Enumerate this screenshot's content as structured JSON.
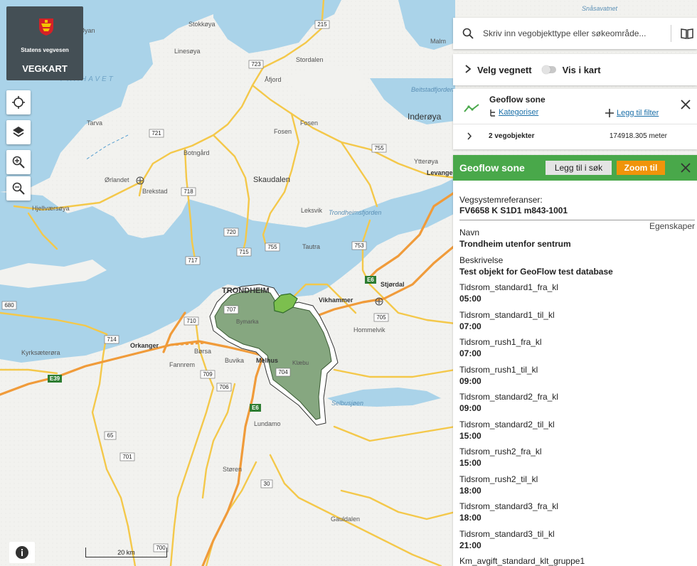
{
  "brand": {
    "org": "Statens vegvesen",
    "app": "VEGKART"
  },
  "search": {
    "placeholder": "Skriv inn vegobjekttype eller søkeområde..."
  },
  "network": {
    "label": "Velg vegnett",
    "toggle_label": "Vis i kart",
    "toggle_on": false
  },
  "object_type": {
    "title": "Geoflow sone",
    "categorize": "Kategoriser",
    "add_filter": "Legg til filter",
    "count": "2 vegobjekter",
    "length": "174918.305 meter"
  },
  "detail": {
    "title": "Geoflow sone",
    "add_search": "Legg til i søk",
    "zoom": "Zoom til",
    "ref_label": "Vegsystemreferanser:",
    "ref_value": "FV6658 K S1D1 m843-1001",
    "section": "Egenskaper",
    "props": [
      {
        "key": "Navn",
        "value": "Trondheim utenfor sentrum"
      },
      {
        "key": "Beskrivelse",
        "value": "Test objekt for GeoFlow test database"
      },
      {
        "key": "Tidsrom_standard1_fra_kl",
        "value": "05:00"
      },
      {
        "key": "Tidsrom_standard1_til_kl",
        "value": "07:00"
      },
      {
        "key": "Tidsrom_rush1_fra_kl",
        "value": "07:00"
      },
      {
        "key": "Tidsrom_rush1_til_kl",
        "value": "09:00"
      },
      {
        "key": "Tidsrom_standard2_fra_kl",
        "value": "09:00"
      },
      {
        "key": "Tidsrom_standard2_til_kl",
        "value": "15:00"
      },
      {
        "key": "Tidsrom_rush2_fra_kl",
        "value": "15:00"
      },
      {
        "key": "Tidsrom_rush2_til_kl",
        "value": "18:00"
      },
      {
        "key": "Tidsrom_standard3_fra_kl",
        "value": "18:00"
      },
      {
        "key": "Tidsrom_standard3_til_kl",
        "value": "21:00"
      },
      {
        "key": "Km_avgift_standard_klt_gruppe1",
        "value": ""
      }
    ]
  },
  "map": {
    "scale": "20 km",
    "sea_label": "FRÅHAVET",
    "city_label": "TRONDHEIM",
    "places": [
      "Stokkøya",
      "Linesøya",
      "Åfjord",
      "Stordalen",
      "Malm",
      "Inderøya",
      "Fosen",
      "Fosen",
      "Tarva",
      "Botngård",
      "Ørlandet",
      "Brekstad",
      "Skaudalen",
      "Ytterøya",
      "Levanger",
      "Hjellværsøya",
      "Leksvik",
      "Trondheimsfjorden",
      "Tautra",
      "Stjørdal",
      "Vikhammer",
      "Hommelvik",
      "Bymarka",
      "Orkanger",
      "Børsa",
      "Fannrem",
      "Buvika",
      "Melhus",
      "Klæbu",
      "Selbusjøen",
      "Kyrksæterøra",
      "Lundamo",
      "Støren",
      "Gauldalen",
      "Beitstadfjorden",
      "Snåsavatnet",
      "Øyan"
    ],
    "road_labels": [
      "215",
      "723",
      "721",
      "755",
      "718",
      "720",
      "715",
      "755",
      "753",
      "717",
      "707",
      "710",
      "714",
      "709",
      "706",
      "704",
      "705",
      "65",
      "701",
      "30",
      "700",
      "680"
    ],
    "e_labels": [
      "E6",
      "E6",
      "E39"
    ],
    "colors": {
      "water": "#aad3e9",
      "land": "#f2f2ef",
      "zone_fill": "#5e8a55",
      "panel_header": "#49a84a",
      "zoom_button": "#f0940a",
      "link": "#1a6fa8"
    }
  }
}
